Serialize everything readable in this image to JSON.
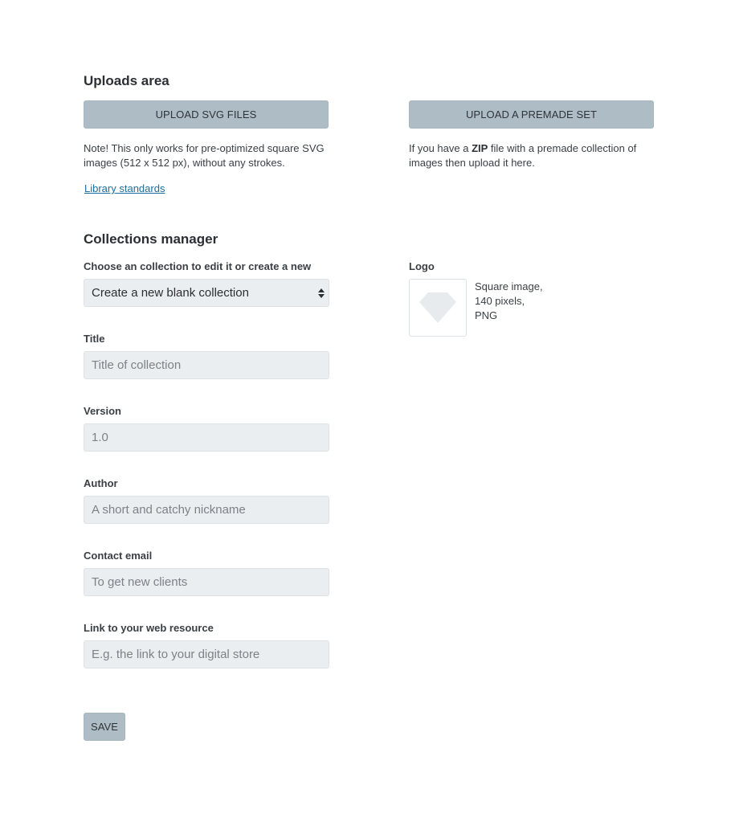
{
  "uploads": {
    "heading": "Uploads area",
    "upload_svg_label": "UPLOAD SVG FILES",
    "svg_note": "Note! This only works for pre-optimized square SVG images (512 x 512 px), without any strokes.",
    "library_link": "Library standards",
    "upload_set_label": "UPLOAD A PREMADE SET",
    "set_note_prefix": "If you have a ",
    "set_note_bold": "ZIP",
    "set_note_suffix": " file with a premade collection of images then upload it here."
  },
  "collections": {
    "heading": "Collections manager",
    "choose_label": "Choose an collection to edit it or create a new",
    "selected_option": "Create a new blank collection",
    "logo": {
      "label": "Logo",
      "hint_line1": "Square image,",
      "hint_line2": "140 pixels,",
      "hint_line3": "PNG",
      "placeholder_icon": "diamond-icon"
    },
    "fields": {
      "title": {
        "label": "Title",
        "placeholder": "Title of collection",
        "value": ""
      },
      "version": {
        "label": "Version",
        "placeholder": "1.0",
        "value": ""
      },
      "author": {
        "label": "Author",
        "placeholder": "A short and catchy nickname",
        "value": ""
      },
      "email": {
        "label": "Contact email",
        "placeholder": "To get new clients",
        "value": ""
      },
      "link": {
        "label": "Link to your web resource",
        "placeholder": "E.g. the link to your digital store",
        "value": ""
      }
    },
    "save_label": "SAVE"
  },
  "colors": {
    "button_bg": "#aebdc5",
    "field_bg": "#ebeef1",
    "link": "#1a6fa0",
    "text": "#2b2f33"
  }
}
